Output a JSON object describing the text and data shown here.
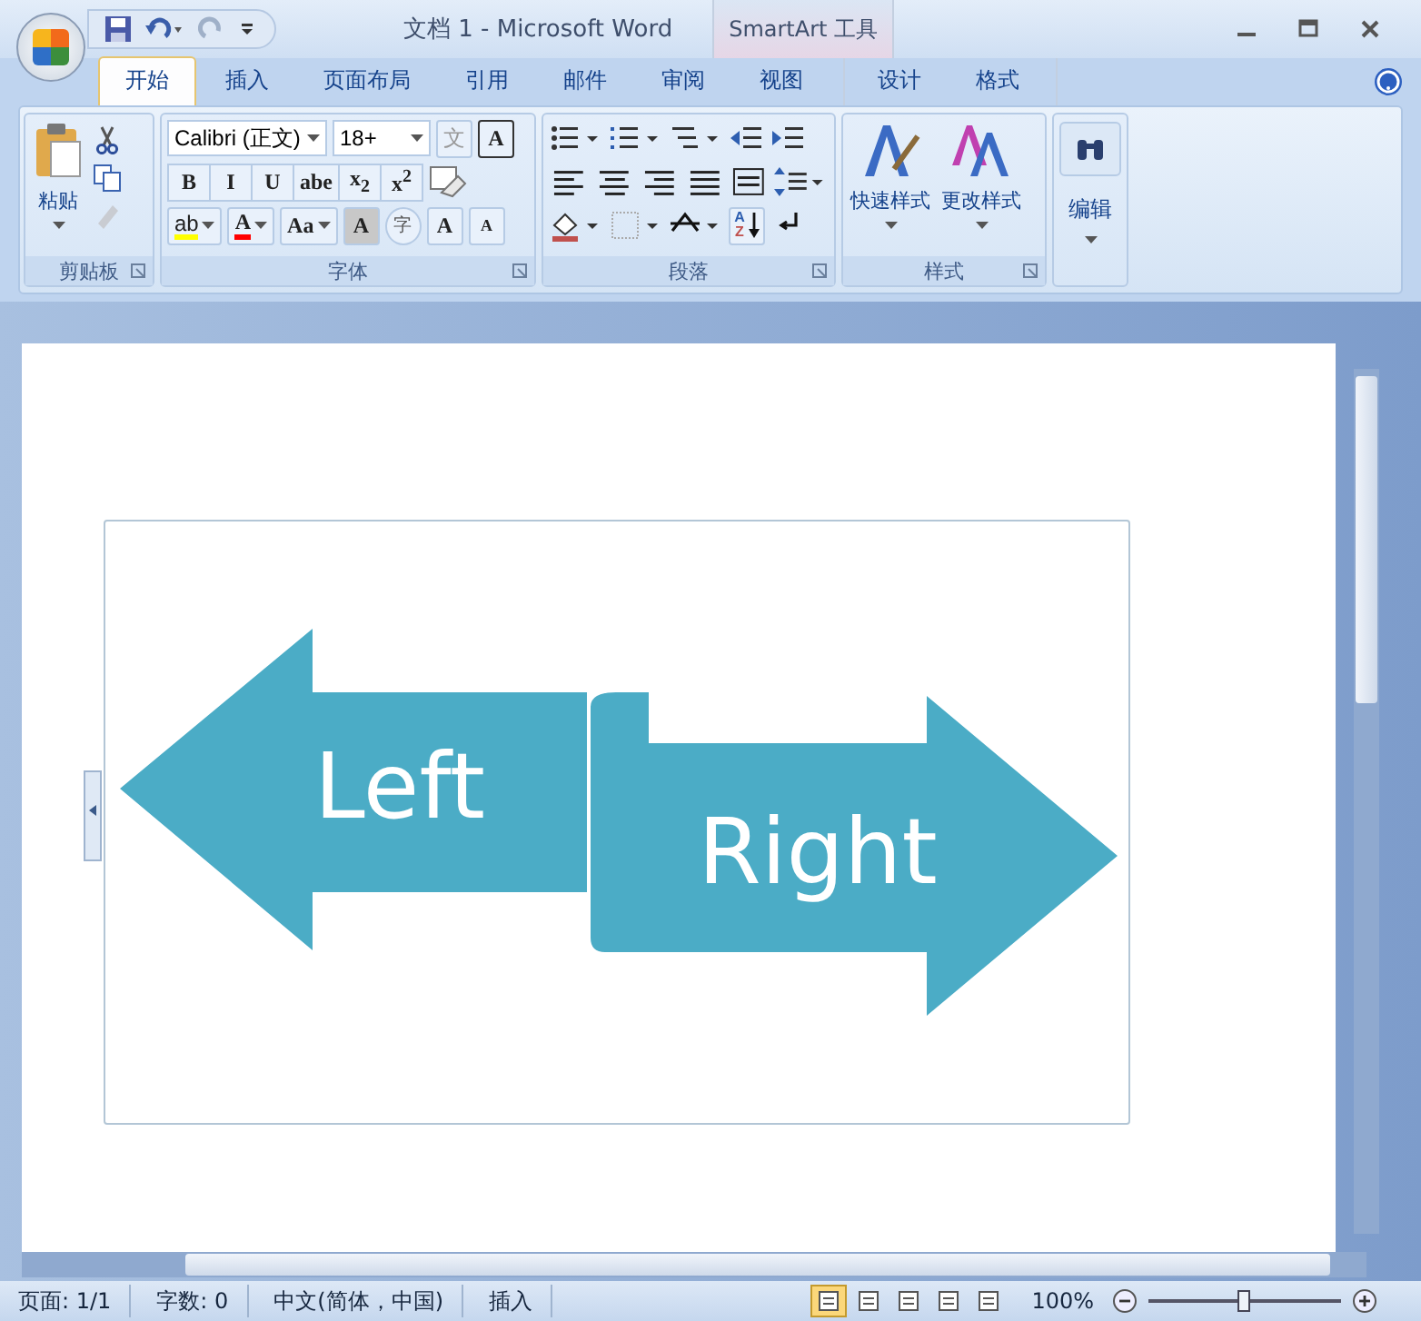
{
  "window": {
    "title": "文档 1 - Microsoft Word",
    "context_group": "SmartArt 工具"
  },
  "tabs": [
    {
      "label": "开始",
      "selected": true
    },
    {
      "label": "插入",
      "selected": false
    },
    {
      "label": "页面布局",
      "selected": false
    },
    {
      "label": "引用",
      "selected": false
    },
    {
      "label": "邮件",
      "selected": false
    },
    {
      "label": "审阅",
      "selected": false
    },
    {
      "label": "视图",
      "selected": false
    }
  ],
  "context_tabs": [
    {
      "label": "设计",
      "selected": false
    },
    {
      "label": "格式",
      "selected": false
    }
  ],
  "ribbon": {
    "clipboard": {
      "label": "剪贴板",
      "paste": "粘贴"
    },
    "font": {
      "label": "字体",
      "font_name": "Calibri (正文)",
      "font_size": "18+",
      "phonetic": "文",
      "border": "A",
      "format_buttons": [
        "B",
        "I",
        "U",
        "abe",
        "x$_{2}$",
        "x$^{2}$"
      ],
      "row3": {
        "highlight": "ab",
        "font_letter": "A",
        "case": "Aa",
        "shading": "A",
        "enclose": "字",
        "grow": "A",
        "shrink": "A"
      }
    },
    "paragraph": {
      "label": "段落",
      "sort": [
        "A",
        "Z"
      ]
    },
    "styles": {
      "label": "样式",
      "quick_styles": "快速样式",
      "change_styles": "更改样式"
    },
    "editing": {
      "label": "编辑"
    }
  },
  "smartart": {
    "shapes": [
      {
        "kind": "left-arrow",
        "text": "Left"
      },
      {
        "kind": "right-arrow",
        "text": "Right"
      }
    ]
  },
  "status_bar": {
    "items": [
      "页面: 1/1",
      "字数: 0",
      "中文(简体，中国)",
      "插入"
    ],
    "views": [
      {
        "selected": true
      },
      {
        "selected": false
      },
      {
        "selected": false
      },
      {
        "selected": false
      },
      {
        "selected": false
      }
    ],
    "zoom": "100%",
    "zoom_level": {
      "level": 0.5
    }
  }
}
